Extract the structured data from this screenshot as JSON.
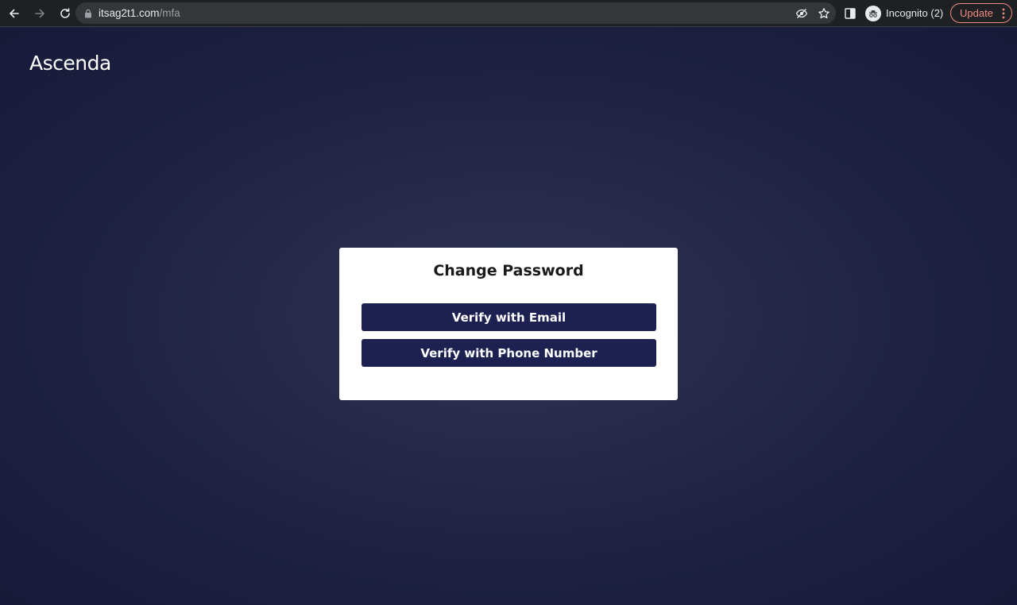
{
  "browser": {
    "url_host": "itsag2t1.com",
    "url_path": "/mfa",
    "profile_label": "Incognito (2)",
    "update_label": "Update",
    "icons": {
      "back": "arrow-left-icon",
      "forward": "arrow-right-icon",
      "reload": "reload-icon",
      "lock": "lock-icon",
      "eye_off": "eye-off-icon",
      "star": "star-icon",
      "side_panel": "side-panel-icon",
      "incognito": "incognito-icon",
      "menu": "more-vert-icon"
    }
  },
  "page": {
    "logo": "Ascenda",
    "card": {
      "title": "Change Password",
      "email_button": "Verify with Email",
      "phone_button": "Verify with Phone Number"
    }
  },
  "colors": {
    "page_background": "#1c1f3e",
    "button_background": "#1d2152",
    "card_background": "#ffffff",
    "update_accent": "#f28b82"
  }
}
